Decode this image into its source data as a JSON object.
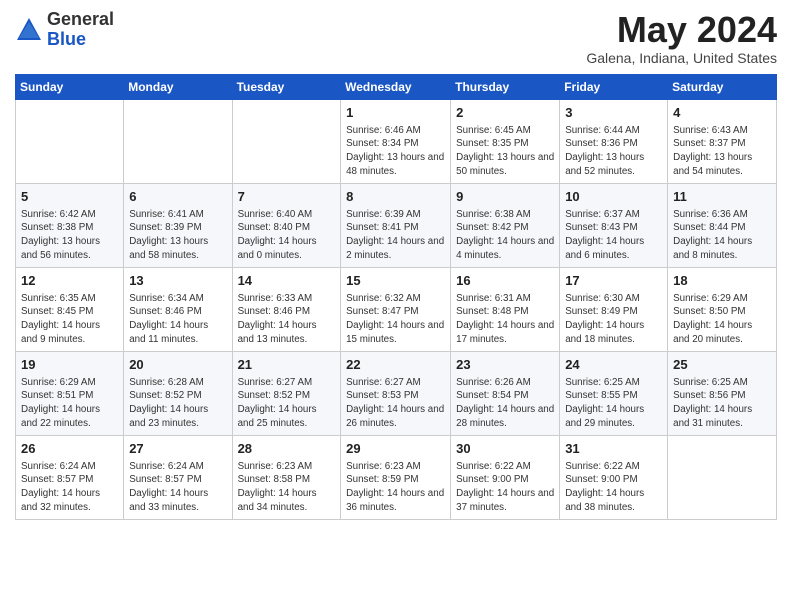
{
  "header": {
    "logo_general": "General",
    "logo_blue": "Blue",
    "month_title": "May 2024",
    "location": "Galena, Indiana, United States"
  },
  "weekdays": [
    "Sunday",
    "Monday",
    "Tuesday",
    "Wednesday",
    "Thursday",
    "Friday",
    "Saturday"
  ],
  "weeks": [
    [
      {
        "day": "",
        "info": ""
      },
      {
        "day": "",
        "info": ""
      },
      {
        "day": "",
        "info": ""
      },
      {
        "day": "1",
        "info": "Sunrise: 6:46 AM\nSunset: 8:34 PM\nDaylight: 13 hours and 48 minutes."
      },
      {
        "day": "2",
        "info": "Sunrise: 6:45 AM\nSunset: 8:35 PM\nDaylight: 13 hours and 50 minutes."
      },
      {
        "day": "3",
        "info": "Sunrise: 6:44 AM\nSunset: 8:36 PM\nDaylight: 13 hours and 52 minutes."
      },
      {
        "day": "4",
        "info": "Sunrise: 6:43 AM\nSunset: 8:37 PM\nDaylight: 13 hours and 54 minutes."
      }
    ],
    [
      {
        "day": "5",
        "info": "Sunrise: 6:42 AM\nSunset: 8:38 PM\nDaylight: 13 hours and 56 minutes."
      },
      {
        "day": "6",
        "info": "Sunrise: 6:41 AM\nSunset: 8:39 PM\nDaylight: 13 hours and 58 minutes."
      },
      {
        "day": "7",
        "info": "Sunrise: 6:40 AM\nSunset: 8:40 PM\nDaylight: 14 hours and 0 minutes."
      },
      {
        "day": "8",
        "info": "Sunrise: 6:39 AM\nSunset: 8:41 PM\nDaylight: 14 hours and 2 minutes."
      },
      {
        "day": "9",
        "info": "Sunrise: 6:38 AM\nSunset: 8:42 PM\nDaylight: 14 hours and 4 minutes."
      },
      {
        "day": "10",
        "info": "Sunrise: 6:37 AM\nSunset: 8:43 PM\nDaylight: 14 hours and 6 minutes."
      },
      {
        "day": "11",
        "info": "Sunrise: 6:36 AM\nSunset: 8:44 PM\nDaylight: 14 hours and 8 minutes."
      }
    ],
    [
      {
        "day": "12",
        "info": "Sunrise: 6:35 AM\nSunset: 8:45 PM\nDaylight: 14 hours and 9 minutes."
      },
      {
        "day": "13",
        "info": "Sunrise: 6:34 AM\nSunset: 8:46 PM\nDaylight: 14 hours and 11 minutes."
      },
      {
        "day": "14",
        "info": "Sunrise: 6:33 AM\nSunset: 8:46 PM\nDaylight: 14 hours and 13 minutes."
      },
      {
        "day": "15",
        "info": "Sunrise: 6:32 AM\nSunset: 8:47 PM\nDaylight: 14 hours and 15 minutes."
      },
      {
        "day": "16",
        "info": "Sunrise: 6:31 AM\nSunset: 8:48 PM\nDaylight: 14 hours and 17 minutes."
      },
      {
        "day": "17",
        "info": "Sunrise: 6:30 AM\nSunset: 8:49 PM\nDaylight: 14 hours and 18 minutes."
      },
      {
        "day": "18",
        "info": "Sunrise: 6:29 AM\nSunset: 8:50 PM\nDaylight: 14 hours and 20 minutes."
      }
    ],
    [
      {
        "day": "19",
        "info": "Sunrise: 6:29 AM\nSunset: 8:51 PM\nDaylight: 14 hours and 22 minutes."
      },
      {
        "day": "20",
        "info": "Sunrise: 6:28 AM\nSunset: 8:52 PM\nDaylight: 14 hours and 23 minutes."
      },
      {
        "day": "21",
        "info": "Sunrise: 6:27 AM\nSunset: 8:52 PM\nDaylight: 14 hours and 25 minutes."
      },
      {
        "day": "22",
        "info": "Sunrise: 6:27 AM\nSunset: 8:53 PM\nDaylight: 14 hours and 26 minutes."
      },
      {
        "day": "23",
        "info": "Sunrise: 6:26 AM\nSunset: 8:54 PM\nDaylight: 14 hours and 28 minutes."
      },
      {
        "day": "24",
        "info": "Sunrise: 6:25 AM\nSunset: 8:55 PM\nDaylight: 14 hours and 29 minutes."
      },
      {
        "day": "25",
        "info": "Sunrise: 6:25 AM\nSunset: 8:56 PM\nDaylight: 14 hours and 31 minutes."
      }
    ],
    [
      {
        "day": "26",
        "info": "Sunrise: 6:24 AM\nSunset: 8:57 PM\nDaylight: 14 hours and 32 minutes."
      },
      {
        "day": "27",
        "info": "Sunrise: 6:24 AM\nSunset: 8:57 PM\nDaylight: 14 hours and 33 minutes."
      },
      {
        "day": "28",
        "info": "Sunrise: 6:23 AM\nSunset: 8:58 PM\nDaylight: 14 hours and 34 minutes."
      },
      {
        "day": "29",
        "info": "Sunrise: 6:23 AM\nSunset: 8:59 PM\nDaylight: 14 hours and 36 minutes."
      },
      {
        "day": "30",
        "info": "Sunrise: 6:22 AM\nSunset: 9:00 PM\nDaylight: 14 hours and 37 minutes."
      },
      {
        "day": "31",
        "info": "Sunrise: 6:22 AM\nSunset: 9:00 PM\nDaylight: 14 hours and 38 minutes."
      },
      {
        "day": "",
        "info": ""
      }
    ]
  ]
}
